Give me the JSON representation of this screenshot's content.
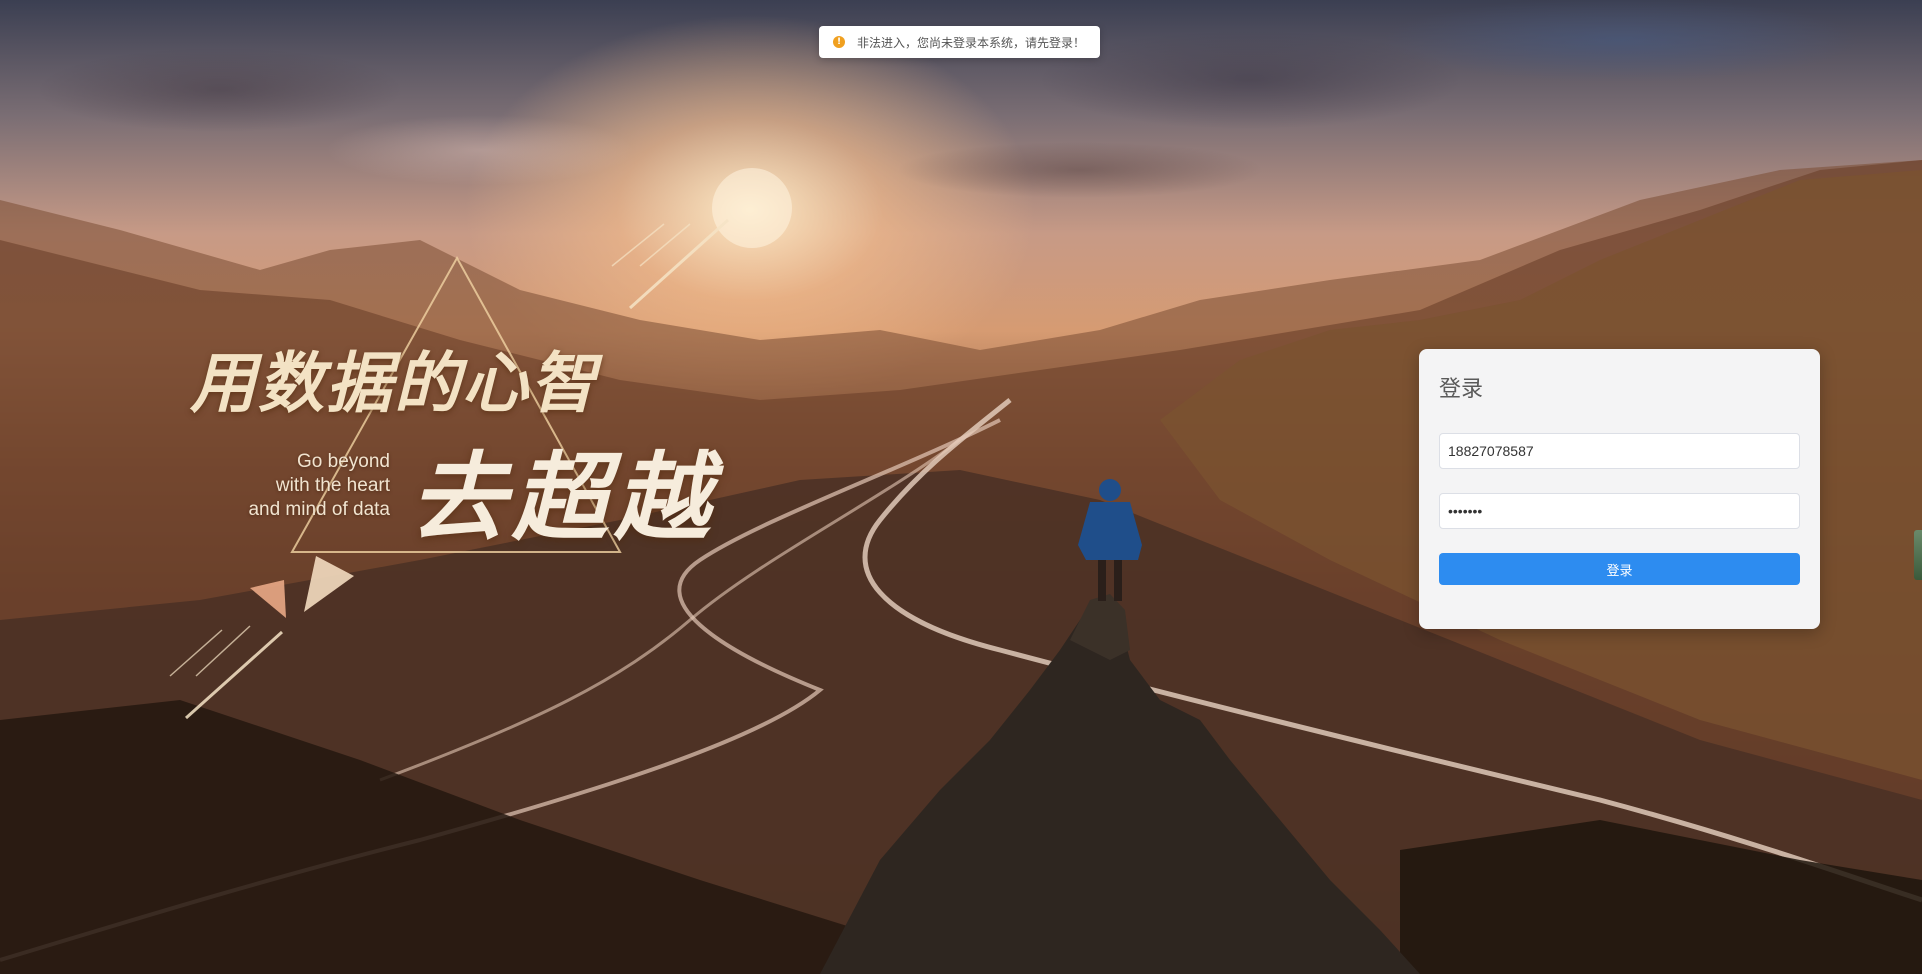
{
  "notification": {
    "icon": "warning-icon",
    "icon_glyph": "!",
    "message": "非法进入，您尚未登录本系统，请先登录！",
    "accent_color": "#f0a020"
  },
  "slogan": {
    "chinese_line1": "用数据的心智",
    "chinese_line2": "去超越",
    "english_lines": [
      "Go beyond",
      "with the heart",
      "and mind of data"
    ]
  },
  "login": {
    "title": "登录",
    "username_value": "18827078587",
    "password_value": "•••••••",
    "submit_label": "登录",
    "button_color": "#2d8cf0"
  }
}
